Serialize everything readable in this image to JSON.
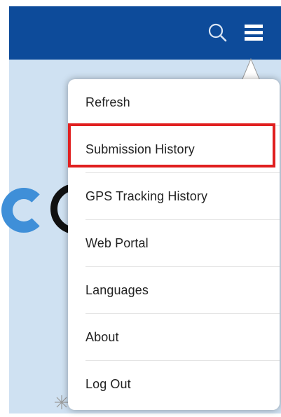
{
  "header": {
    "search_icon": "search-icon",
    "menu_icon": "hamburger-menu-icon",
    "color": "#0d4b9a"
  },
  "menu": {
    "items": [
      {
        "label": "Refresh"
      },
      {
        "label": "Submission History",
        "highlighted": true
      },
      {
        "label": "GPS Tracking History"
      },
      {
        "label": "Web Portal"
      },
      {
        "label": "Languages"
      },
      {
        "label": "About"
      },
      {
        "label": "Log Out"
      }
    ],
    "highlight_color": "#e01f1f"
  },
  "background": {
    "logo_colors": [
      "#3f8fd8",
      "#111111"
    ]
  }
}
